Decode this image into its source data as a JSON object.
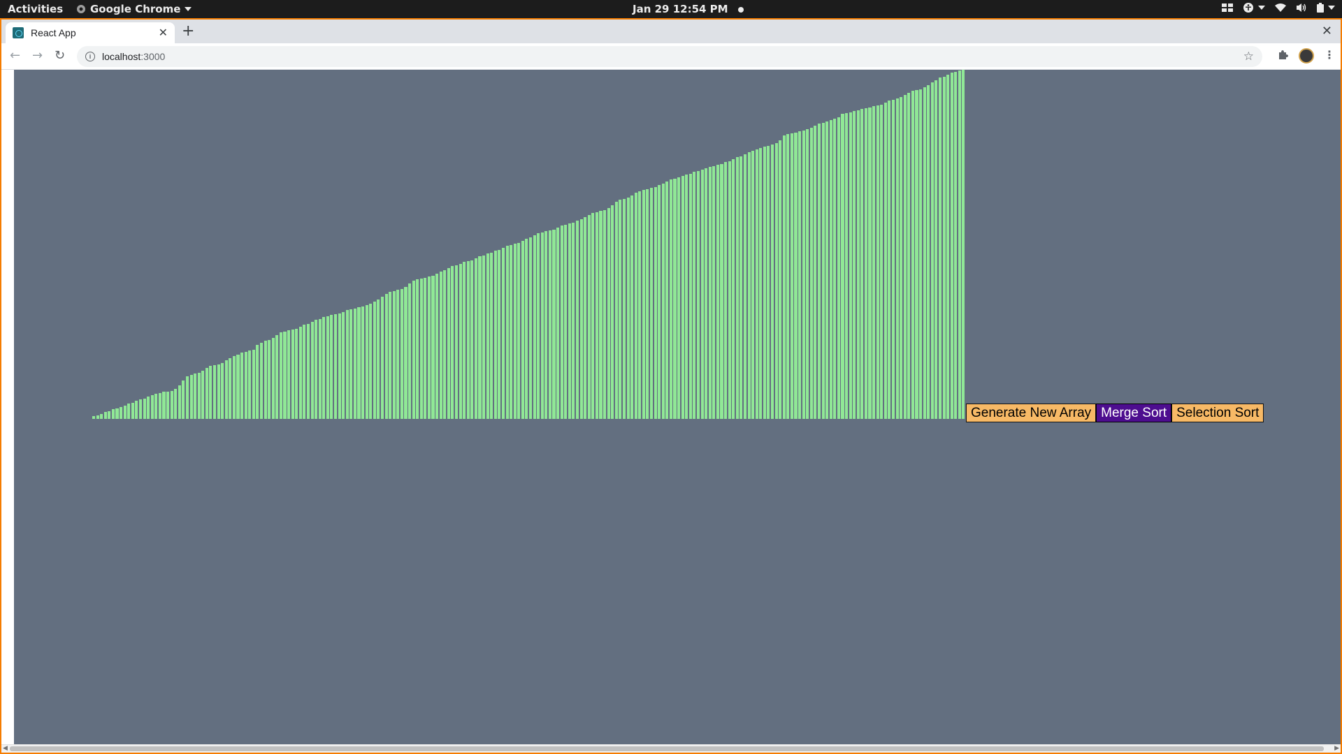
{
  "topbar": {
    "activities": "Activities",
    "app_name": "Google Chrome",
    "clock": "Jan 29  12:54 PM"
  },
  "browser": {
    "tab_title": "React App",
    "tab_close": "✕",
    "new_tab": "+",
    "window_close": "✕",
    "url_host": "localhost",
    "url_port": ":3000"
  },
  "app": {
    "bar_color": "#90e896",
    "background": "#636f80",
    "array_values": [
      3,
      4,
      5,
      7,
      8,
      10,
      11,
      12,
      14,
      16,
      17,
      19,
      20,
      21,
      23,
      25,
      26,
      27,
      28,
      28,
      29,
      31,
      35,
      40,
      44,
      46,
      47,
      48,
      50,
      53,
      55,
      56,
      57,
      58,
      61,
      63,
      65,
      67,
      69,
      70,
      71,
      72,
      77,
      79,
      81,
      82,
      84,
      87,
      90,
      91,
      92,
      93,
      94,
      96,
      98,
      99,
      101,
      103,
      104,
      106,
      107,
      108,
      109,
      110,
      111,
      113,
      114,
      115,
      116,
      117,
      118,
      120,
      122,
      124,
      127,
      130,
      132,
      133,
      134,
      135,
      137,
      141,
      144,
      145,
      146,
      147,
      148,
      149,
      151,
      153,
      155,
      157,
      159,
      160,
      161,
      163,
      164,
      165,
      167,
      169,
      170,
      172,
      173,
      175,
      176,
      178,
      180,
      181,
      182,
      183,
      185,
      187,
      189,
      191,
      193,
      194,
      195,
      196,
      197,
      199,
      201,
      202,
      203,
      204,
      206,
      208,
      210,
      212,
      214,
      215,
      216,
      217,
      219,
      222,
      226,
      228,
      229,
      230,
      232,
      235,
      237,
      238,
      239,
      240,
      241,
      243,
      245,
      247,
      249,
      250,
      251,
      253,
      254,
      255,
      257,
      258,
      259,
      261,
      262,
      263,
      264,
      265,
      267,
      268,
      270,
      272,
      273,
      275,
      277,
      279,
      280,
      282,
      283,
      284,
      285,
      287,
      290,
      295,
      296,
      297,
      298,
      299,
      300,
      301,
      303,
      305,
      307,
      308,
      309,
      311,
      312,
      314,
      317,
      318,
      319,
      320,
      321,
      322,
      323,
      324,
      325,
      326,
      327,
      329,
      331,
      332,
      333,
      335,
      337,
      339,
      341,
      342,
      343,
      345,
      347,
      350,
      352,
      355,
      356,
      358,
      360,
      361,
      362,
      363
    ]
  },
  "controls": {
    "generate_label": "Generate New Array",
    "merge_label": "Merge Sort",
    "selection_label": "Selection Sort"
  }
}
